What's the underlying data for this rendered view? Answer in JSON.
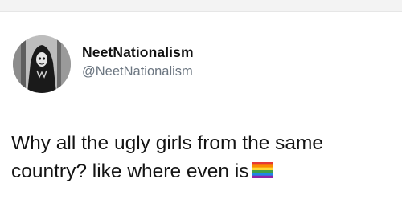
{
  "tweet": {
    "author": {
      "display_name": "NeetNationalism",
      "handle": "@NeetNationalism",
      "avatar_icon": "dark-figure-avatar"
    },
    "text_lines": [
      "Why all the ugly girls from the same",
      "country? like where even is"
    ],
    "emoji": "rainbow-flag-icon",
    "colors": {
      "text": "#141414",
      "handle": "#6b7580",
      "background": "#ffffff",
      "flag_stripes": [
        "#e53935",
        "#fb8c00",
        "#fdd835",
        "#43a047",
        "#1e88e5",
        "#8e24aa"
      ]
    }
  }
}
